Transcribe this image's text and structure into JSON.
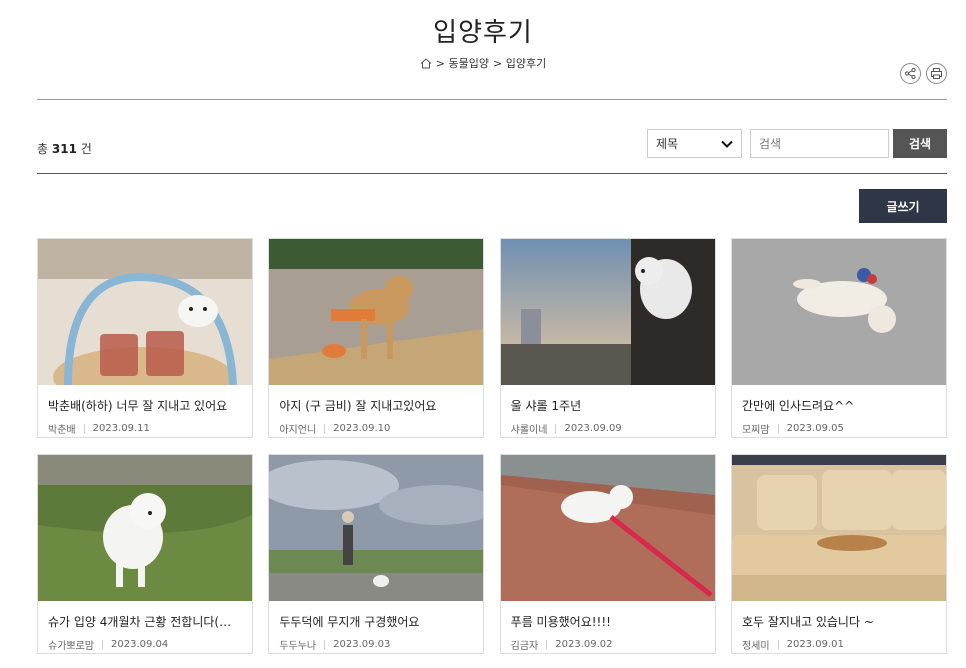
{
  "page": {
    "title": "입양후기",
    "breadcrumb": [
      "> 동물입양",
      "> 입양후기"
    ]
  },
  "toolbar": {
    "icons": [
      "share-icon",
      "print-icon"
    ],
    "total_prefix": "총",
    "total_count": "311",
    "total_suffix": "건"
  },
  "search": {
    "select_value": "제목",
    "placeholder": "검색",
    "button_label": "검색"
  },
  "write_button": "글쓰기",
  "cards": [
    {
      "title": "박춘배(하하) 너무 잘 지내고 있어요",
      "author": "박춘배",
      "date": "2023.09.11"
    },
    {
      "title": "아지 (구 금비) 잘 지내고있어요",
      "author": "아지언니",
      "date": "2023.09.10"
    },
    {
      "title": "울 샤롤 1주년",
      "author": "샤롤이네",
      "date": "2023.09.09"
    },
    {
      "title": "간만에 인사드려요^^",
      "author": "모찌맘",
      "date": "2023.09.05"
    },
    {
      "title": "슈가 입양 4개월차 근황 전합니다(뽀로 …",
      "author": "슈가뽀로맘",
      "date": "2023.09.04"
    },
    {
      "title": "두두덕에 무지개 구경했어요",
      "author": "두두누나",
      "date": "2023.09.03"
    },
    {
      "title": "푸름 미용했어요!!!!",
      "author": "김금자",
      "date": "2023.09.02"
    },
    {
      "title": "호두 잘지내고 있습니다 ~",
      "author": "정세미",
      "date": "2023.09.01"
    }
  ]
}
